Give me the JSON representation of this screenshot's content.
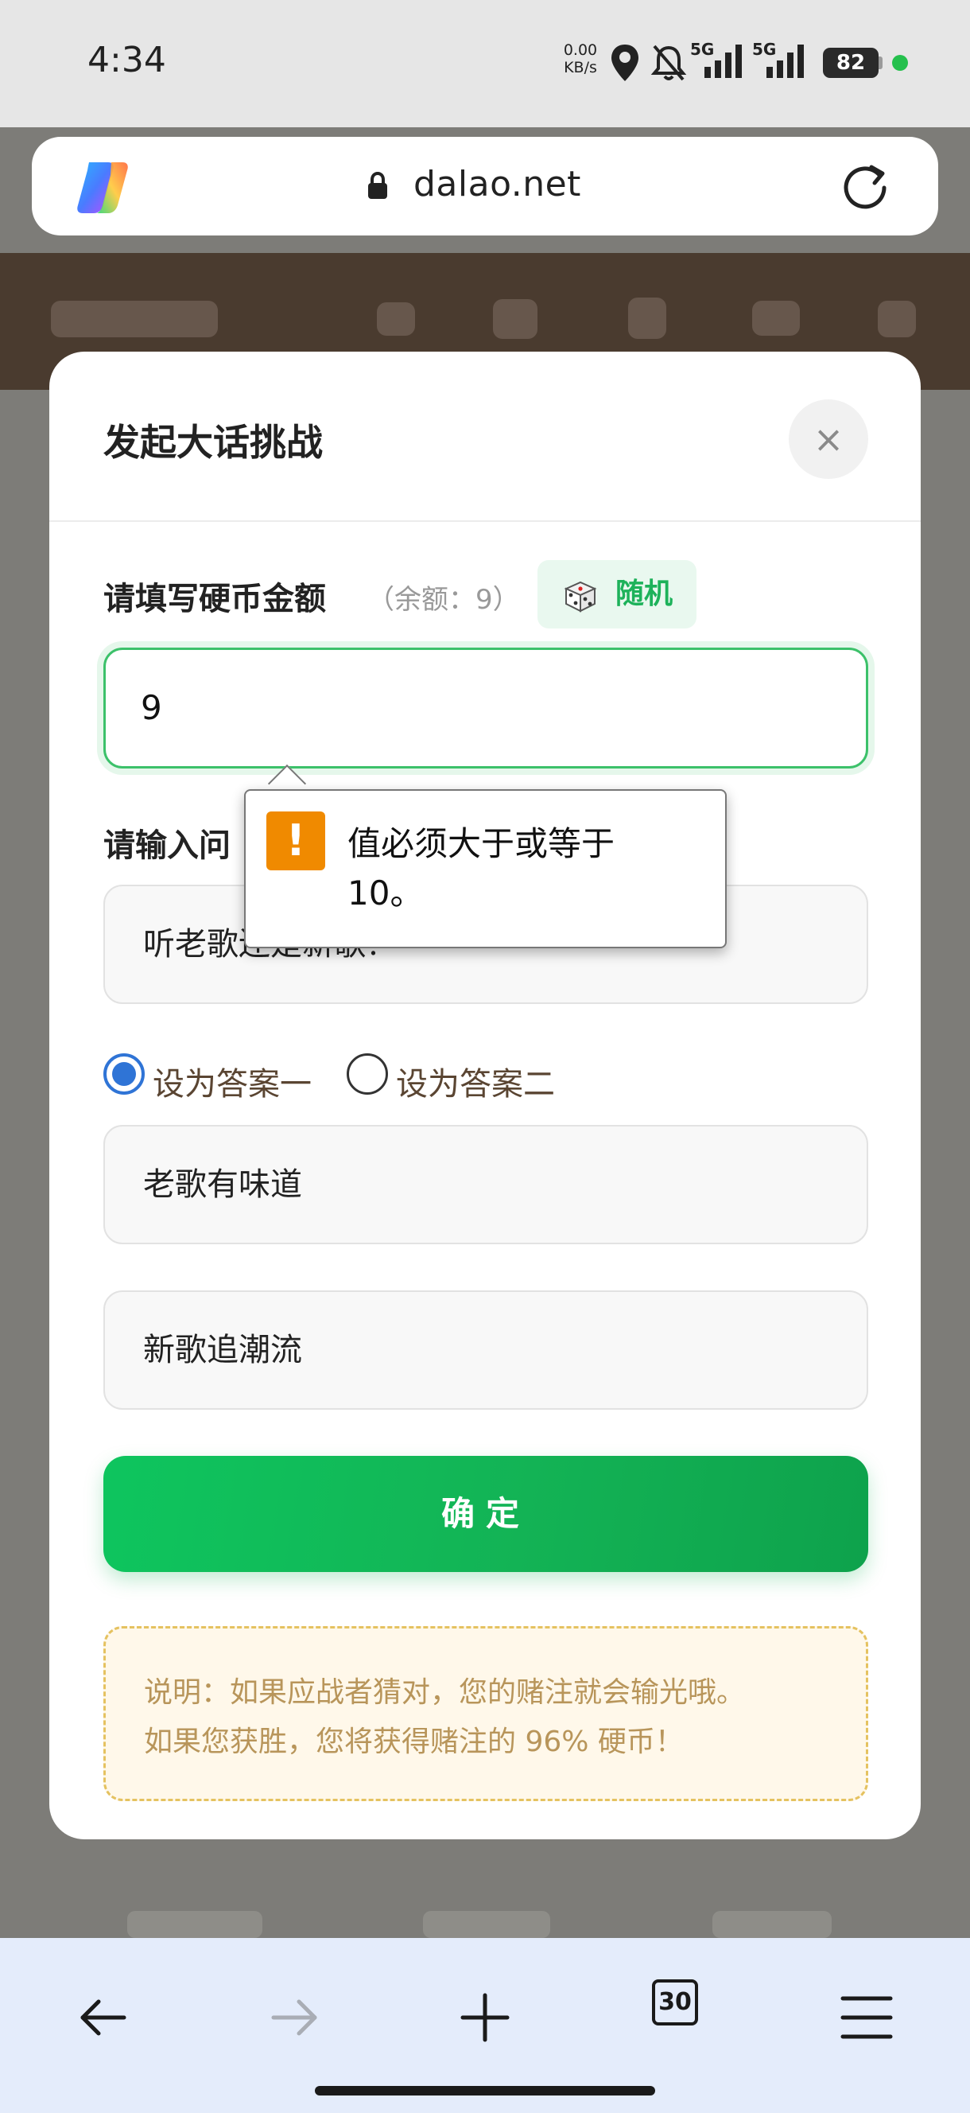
{
  "status_bar": {
    "time": "4:34",
    "net_speed_value": "0.00",
    "net_speed_unit": "KB/s",
    "network_1": "5G",
    "network_2": "5G",
    "battery": "82"
  },
  "browser": {
    "url": "dalao.net",
    "tabs_count": "30"
  },
  "modal": {
    "title": "发起大话挑战",
    "close_symbol": "×",
    "coin_label": "请填写硬币金额",
    "coin_balance": "（余额：9）",
    "random_label": "随机",
    "coin_value": "9",
    "question_label": "请输入问",
    "question_value": "听老歌还是新歌？",
    "radio_1_label": "设为答案一",
    "radio_2_label": "设为答案二",
    "answer_1": "老歌有味道",
    "answer_2": "新歌追潮流",
    "confirm_label": "确定",
    "note_line_1": "说明：如果应战者猜对，您的赌注就会输光哦。",
    "note_line_2": "如果您获胜，您将获得赌注的 96% 硬币！"
  },
  "tooltip": {
    "icon_symbol": "!",
    "message": "值必须大于或等于 10。"
  },
  "colors": {
    "accent_green": "#13b355",
    "radio_blue": "#2f74d6",
    "warning_orange": "#f08a00",
    "note_text": "#b8955a"
  }
}
